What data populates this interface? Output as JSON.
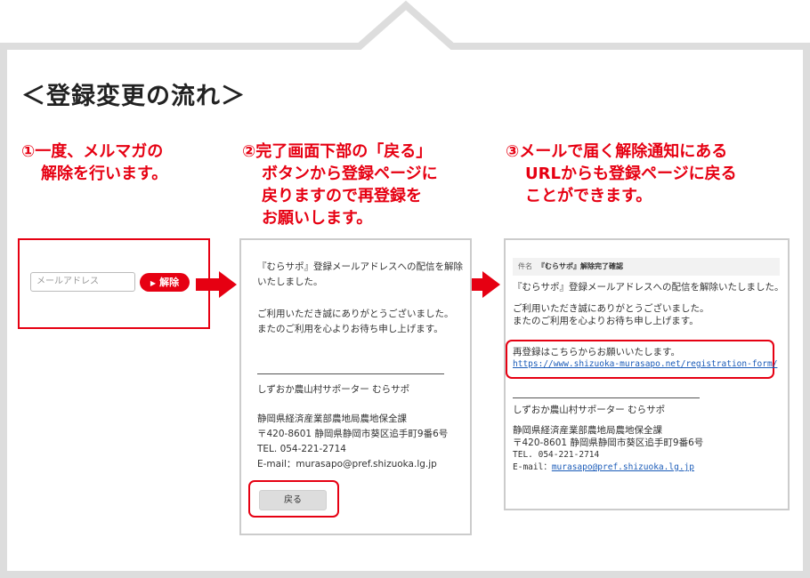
{
  "title": "＜登録変更の流れ＞",
  "steps": [
    {
      "line1": "①一度、メルマガの",
      "line2": "解除を行います。"
    },
    {
      "line1": "②完了画面下部の「戻る」",
      "line2": "ボタンから登録ページに",
      "line3": "戻りますので再登録を",
      "line4": "お願いします。"
    },
    {
      "line1": "③メールで届く解除通知にある",
      "line2": "URLからも登録ページに戻る",
      "line3": "ことができます。"
    }
  ],
  "panel1": {
    "email_placeholder": "メールアドレス",
    "cancel_label": "解除"
  },
  "panel2": {
    "msg1a": "『むらサポ』登録メールアドレスへの配信を解除",
    "msg1b": "いたしました。",
    "msg2a": "ご利用いただき誠にありがとうございました。",
    "msg2b": "またのご利用を心よりお待ち申し上げます。",
    "org_name": "しずおか農山村サポーター むらサポ",
    "dept": "静岡県経済産業部農地局農地保全課",
    "address": "〒420-8601 静岡県静岡市葵区追手町9番6号",
    "tel": "TEL. 054-221-2714",
    "email": "E-mail：murasapo@pref.shizuoka.lg.jp",
    "back_label": "戻る"
  },
  "panel3": {
    "subject_label": "件名",
    "subject_value": "『むらサポ』解除完了確認",
    "msg1": "『むらサポ』登録メールアドレスへの配信を解除いたしました。",
    "msg2a": "ご利用いただき誠にありがとうございました。",
    "msg2b": "またのご利用を心よりお待ち申し上げます。",
    "rereg_text": "再登録はこちらからお願いいたします。",
    "rereg_url": "https://www.shizuoka-murasapo.net/registration-form/",
    "org_name": "しずおか農山村サポーター むらサポ",
    "dept": "静岡県経済産業部農地局農地保全課",
    "address": "〒420-8601 静岡県静岡市葵区追手町9番6号",
    "tel": "TEL. 054-221-2714",
    "email_label": "E-mail：",
    "email": "murasapo@pref.shizuoka.lg.jp"
  },
  "colors": {
    "accent": "#e60012",
    "frame": "#dddddd",
    "link": "#1a5bb8"
  }
}
